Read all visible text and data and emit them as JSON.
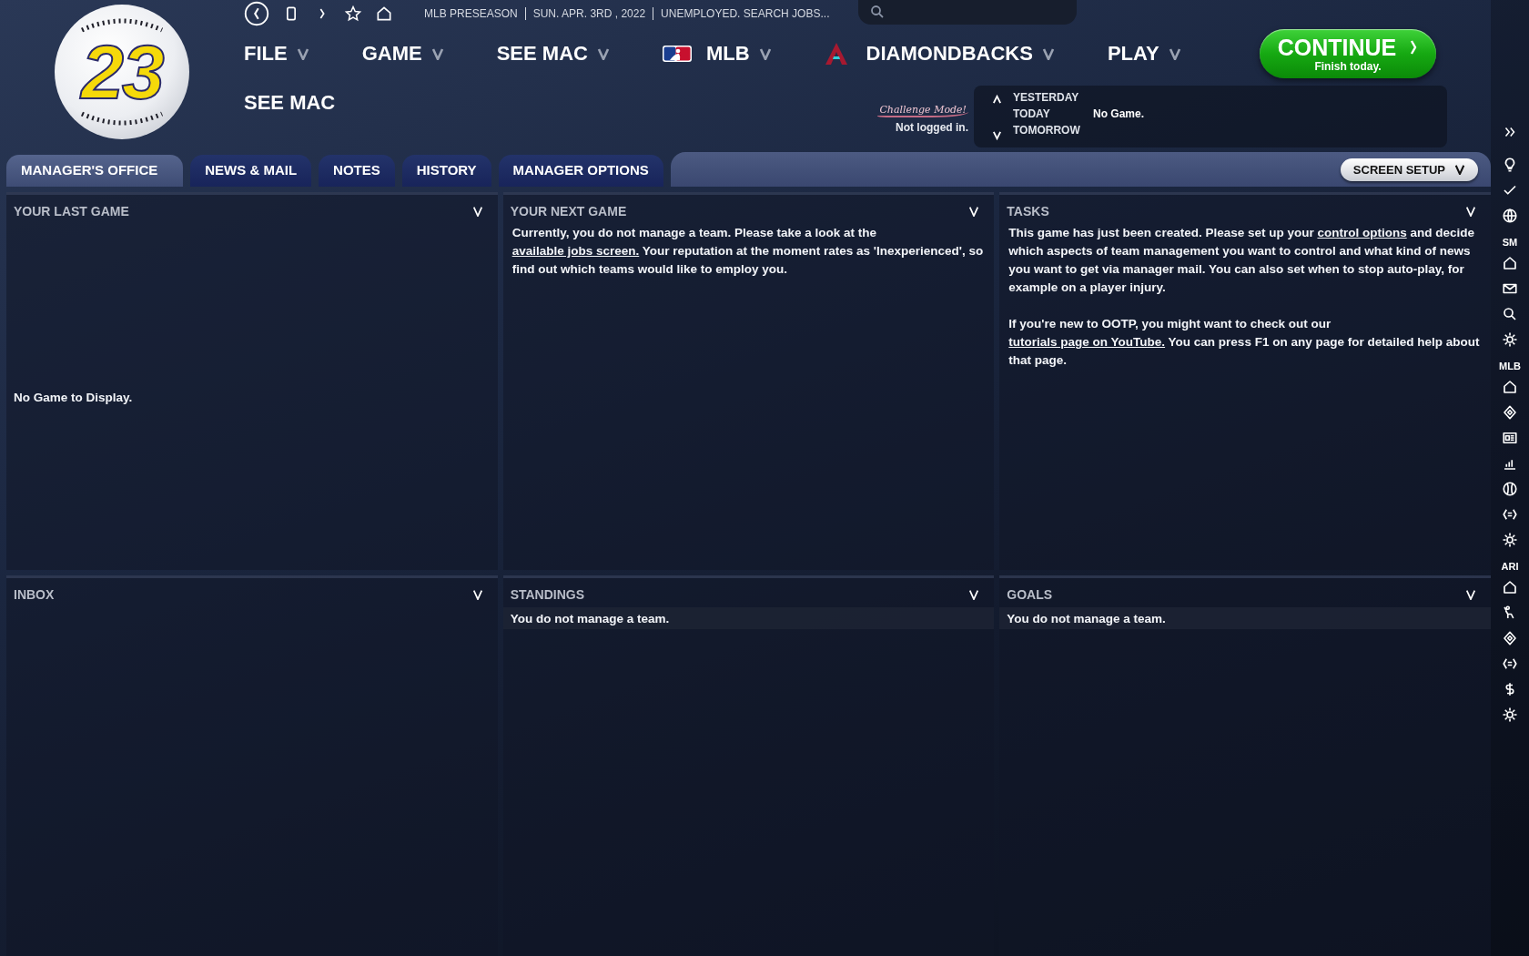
{
  "logo": {
    "text": "23"
  },
  "top_bar": {
    "status": [
      "MLB PRESEASON",
      "SUN. APR. 3RD , 2022",
      "UNEMPLOYED. SEARCH JOBS..."
    ]
  },
  "menu": [
    {
      "label": "FILE",
      "kind": "plain",
      "dropdown": true
    },
    {
      "label": "GAME",
      "kind": "plain",
      "dropdown": true
    },
    {
      "label": "SEE MAC",
      "kind": "plain",
      "dropdown": true
    },
    {
      "label": "MLB",
      "kind": "league",
      "dropdown": true
    },
    {
      "label": "DIAMONDBACKS",
      "kind": "team",
      "dropdown": true
    },
    {
      "label": "PLAY",
      "kind": "plain",
      "dropdown": true
    }
  ],
  "menu_second_row": [
    {
      "label": "SEE MAC",
      "dropdown": false
    }
  ],
  "challenge": {
    "badge": "Challenge Mode!",
    "status": "Not logged in."
  },
  "day_nav": [
    {
      "label": "YESTERDAY"
    },
    {
      "label": "TODAY",
      "info": "No Game."
    },
    {
      "label": "TOMORROW"
    }
  ],
  "continue_button": {
    "label": "CONTINUE",
    "subtitle": "Finish today."
  },
  "tabs": [
    {
      "label": "MANAGER'S OFFICE",
      "selected": true
    },
    {
      "label": "NEWS & MAIL",
      "selected": false
    },
    {
      "label": "NOTES",
      "selected": false
    },
    {
      "label": "HISTORY",
      "selected": false
    },
    {
      "label": "MANAGER OPTIONS",
      "selected": false
    }
  ],
  "screen_setup": {
    "label": "SCREEN SETUP"
  },
  "panels": [
    {
      "title": "YOUR LAST GAME",
      "kind": "message",
      "message": "No Game to Display."
    },
    {
      "title": "YOUR NEXT GAME",
      "kind": "text",
      "paragraphs": [
        [
          {
            "text": "Currently, you do not manage a team. Please take a look at the ",
            "link": false
          },
          {
            "text": "available jobs screen.",
            "link": true
          },
          {
            "text": " Your reputation at the moment rates as 'Inexperienced', so find out which teams would like to employ you.",
            "link": false
          }
        ]
      ]
    },
    {
      "title": "TASKS",
      "kind": "text",
      "paragraphs": [
        [
          {
            "text": "This game has just been created. Please set up your ",
            "link": false
          },
          {
            "text": "control options",
            "link": true
          },
          {
            "text": " and decide which aspects of team management you want to control and what kind of news you want to get via manager mail. You can also set when to stop auto-play, for example on a player injury.",
            "link": false
          }
        ],
        [
          {
            "text": "If you're new to OOTP, you might want to check out our ",
            "link": false
          },
          {
            "text": "tutorials page on YouTube.",
            "link": true
          },
          {
            "text": " You can press F1 on any page for detailed help about that page.",
            "link": false
          }
        ]
      ]
    },
    {
      "title": "INBOX",
      "kind": "empty"
    },
    {
      "title": "STANDINGS",
      "kind": "notice",
      "message": "You do not manage a team."
    },
    {
      "title": "GOALS",
      "kind": "notice",
      "message": "You do not manage a team."
    }
  ],
  "sidebar_groups": [
    {
      "label": "SM"
    },
    {
      "label": "MLB"
    },
    {
      "label": "ARI"
    }
  ]
}
